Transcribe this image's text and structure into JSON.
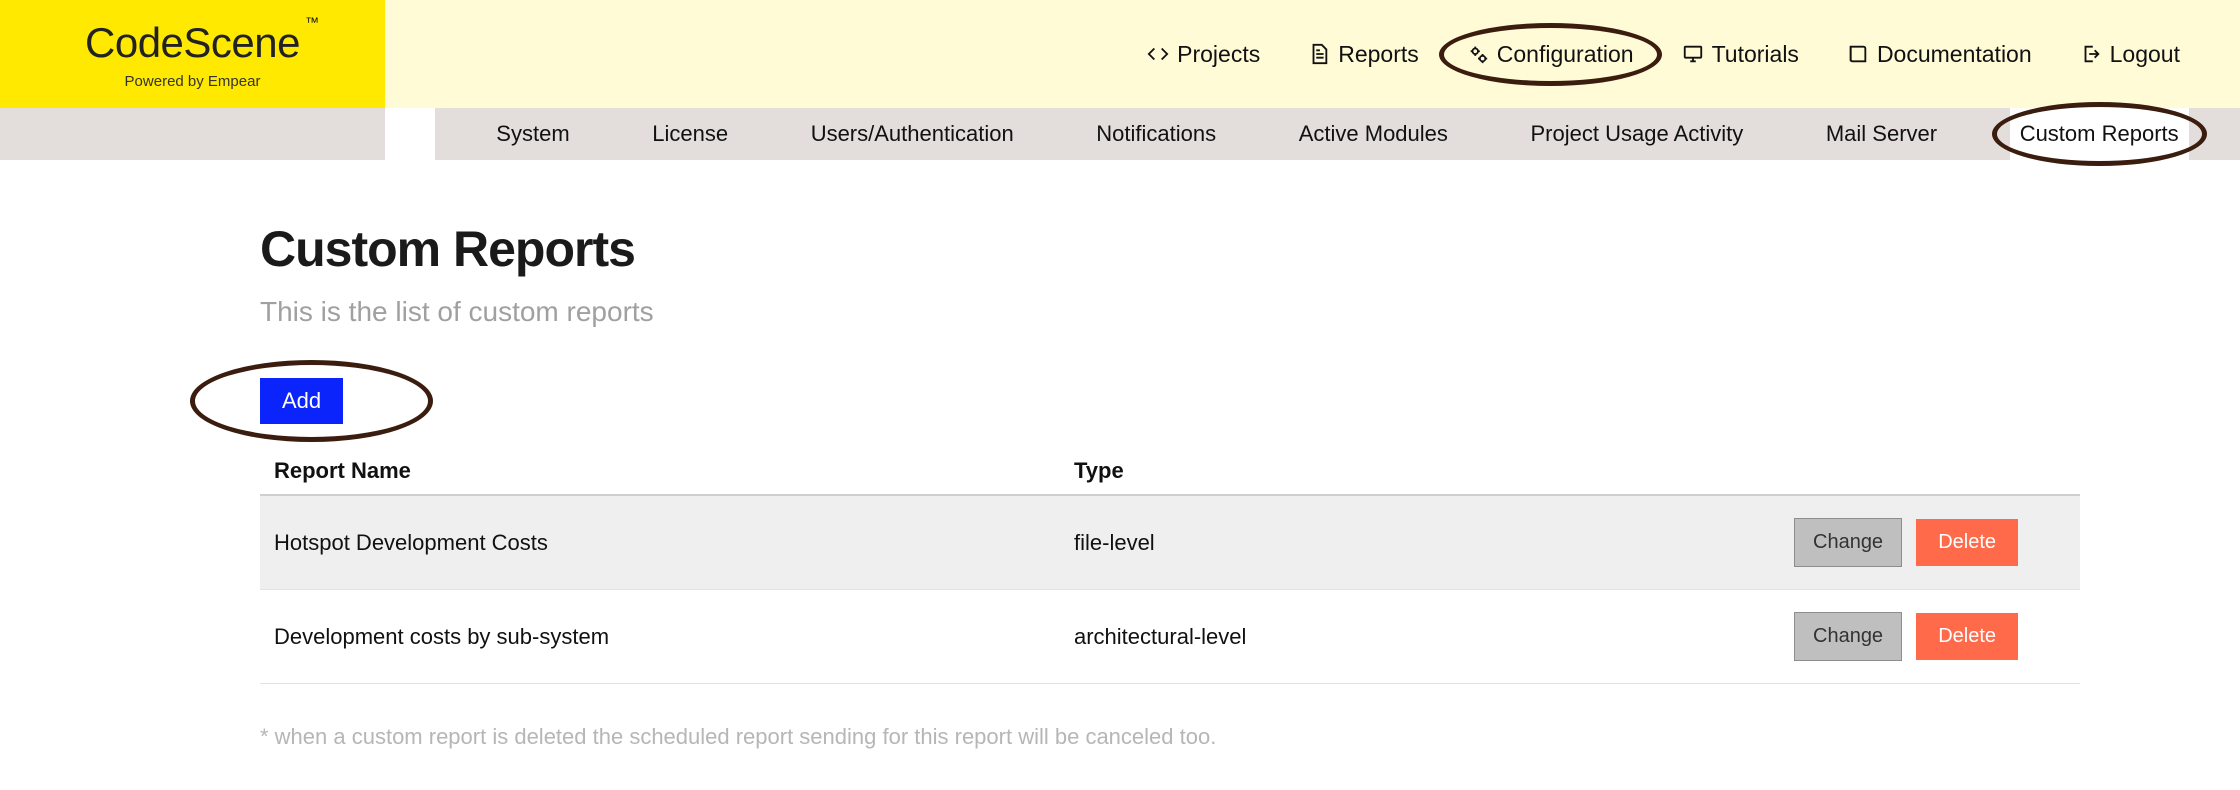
{
  "logo": {
    "name": "CodeScene",
    "tm": "™",
    "subtitle": "Powered by Empear"
  },
  "topnav": {
    "projects": "Projects",
    "reports": "Reports",
    "configuration": "Configuration",
    "tutorials": "Tutorials",
    "documentation": "Documentation",
    "logout": "Logout"
  },
  "subnav": {
    "system": "System",
    "license": "License",
    "users": "Users/Authentication",
    "notifications": "Notifications",
    "modules": "Active Modules",
    "usage": "Project Usage Activity",
    "mail": "Mail Server",
    "custom": "Custom Reports"
  },
  "page": {
    "title": "Custom Reports",
    "subtitle": "This is the list of custom reports",
    "add_label": "Add",
    "footnote": "* when a custom report is deleted the scheduled report sending for this report will be canceled too."
  },
  "table": {
    "headers": {
      "name": "Report Name",
      "type": "Type"
    },
    "change_label": "Change",
    "delete_label": "Delete",
    "rows": [
      {
        "name": "Hotspot Development Costs",
        "type": "file-level"
      },
      {
        "name": "Development costs by sub-system",
        "type": "architectural-level"
      }
    ]
  }
}
